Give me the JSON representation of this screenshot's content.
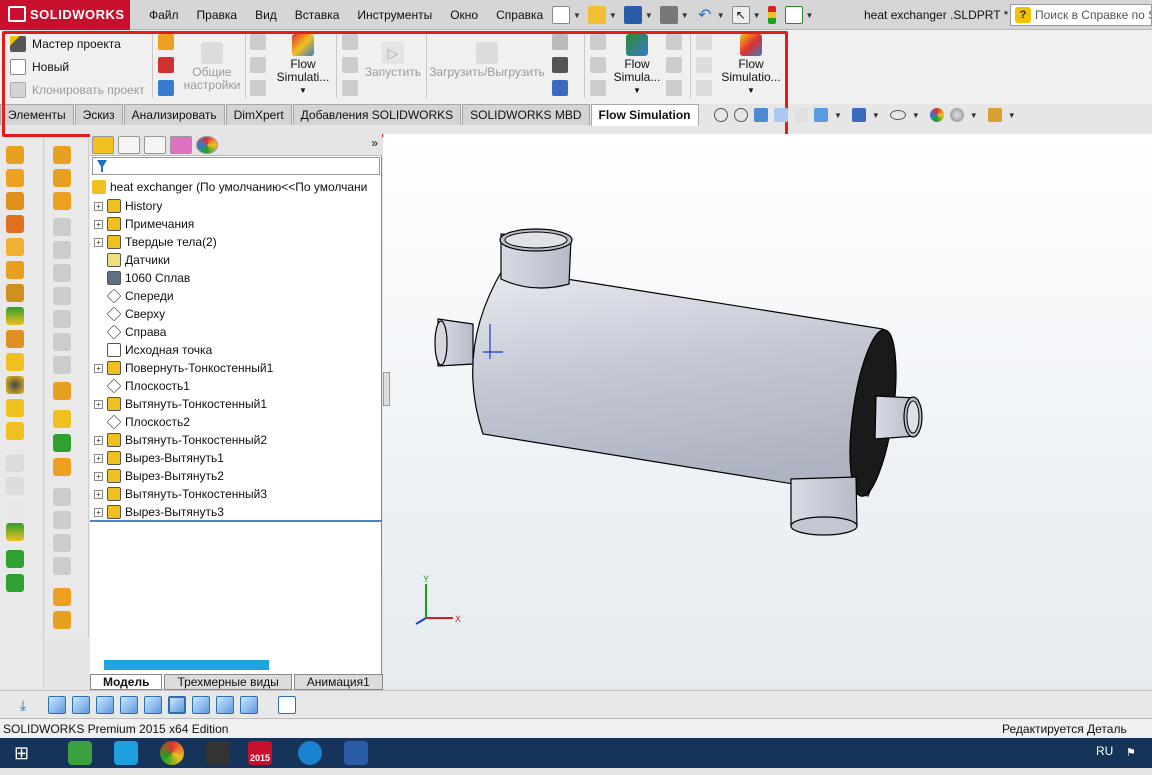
{
  "app": {
    "name": "SOLIDWORKS",
    "document_title": "heat exchanger .SLDPRT *"
  },
  "menu": [
    "Файл",
    "Правка",
    "Вид",
    "Вставка",
    "Инструменты",
    "Окно",
    "Справка"
  ],
  "help_search": {
    "placeholder": "Поиск в Справке по SOLIDWORKS"
  },
  "command_manager": {
    "project_wizard": "Мастер проекта",
    "new": "Новый",
    "clone_project": "Клонировать проект",
    "general_settings_line1": "Общие",
    "general_settings_line2": "настройки",
    "flow_sim_1_line1": "Flow",
    "flow_sim_1_line2": "Simulati...",
    "run": "Запустить",
    "load_unload": "Загрузить/Выгрузить",
    "flow_sim_2_line1": "Flow",
    "flow_sim_2_line2": "Simula...",
    "flow_sim_3_line1": "Flow",
    "flow_sim_3_line2": "Simulatio..."
  },
  "ribbon_tabs": [
    "Элементы",
    "Эскиз",
    "Анализировать",
    "DimXpert",
    "Добавления SOLIDWORKS",
    "SOLIDWORKS MBD",
    "Flow Simulation"
  ],
  "active_ribbon_tab": "Flow Simulation",
  "tree": {
    "root": "heat exchanger  (По умолчанию<<По умолчани",
    "items": [
      {
        "label": "History",
        "expandable": true,
        "icon": "history-icon"
      },
      {
        "label": "Примечания",
        "expandable": true,
        "icon": "annotations-icon"
      },
      {
        "label": "Твердые тела(2)",
        "expandable": true,
        "icon": "solid-bodies-folder-icon"
      },
      {
        "label": "Датчики",
        "expandable": false,
        "icon": "sensors-icon"
      },
      {
        "label": "1060 Сплав",
        "expandable": false,
        "icon": "material-icon"
      },
      {
        "label": "Спереди",
        "expandable": false,
        "icon": "plane-icon"
      },
      {
        "label": "Сверху",
        "expandable": false,
        "icon": "plane-icon"
      },
      {
        "label": "Справа",
        "expandable": false,
        "icon": "plane-icon"
      },
      {
        "label": "Исходная точка",
        "expandable": false,
        "icon": "origin-icon"
      },
      {
        "label": "Повернуть-Тонкостенный1",
        "expandable": true,
        "icon": "revolve-icon"
      },
      {
        "label": "Плоскость1",
        "expandable": false,
        "icon": "plane-icon"
      },
      {
        "label": "Вытянуть-Тонкостенный1",
        "expandable": true,
        "icon": "extrude-icon"
      },
      {
        "label": "Плоскость2",
        "expandable": false,
        "icon": "plane-icon"
      },
      {
        "label": "Вытянуть-Тонкостенный2",
        "expandable": true,
        "icon": "extrude-icon"
      },
      {
        "label": "Вырез-Вытянуть1",
        "expandable": true,
        "icon": "cut-extrude-icon"
      },
      {
        "label": "Вырез-Вытянуть2",
        "expandable": true,
        "icon": "cut-extrude-icon"
      },
      {
        "label": "Вытянуть-Тонкостенный3",
        "expandable": true,
        "icon": "extrude-icon"
      },
      {
        "label": "Вырез-Вытянуть3",
        "expandable": true,
        "icon": "cut-extrude-icon"
      }
    ]
  },
  "bottom_tabs": [
    "Модель",
    "Трехмерные виды",
    "Анимация1"
  ],
  "active_bottom_tab": "Модель",
  "triad": {
    "x": "X",
    "y": "Y"
  },
  "status": {
    "left": "SOLIDWORKS Premium 2015 x64 Edition",
    "right": "Редактируется Деталь"
  },
  "taskbar": {
    "lang": "RU",
    "solidworks_badge": "2015"
  },
  "colors": {
    "brand_red": "#c8102e",
    "highlight_box": "#e41b1b",
    "taskbar": "#16345a",
    "model_gray": "#c9ccd6"
  }
}
